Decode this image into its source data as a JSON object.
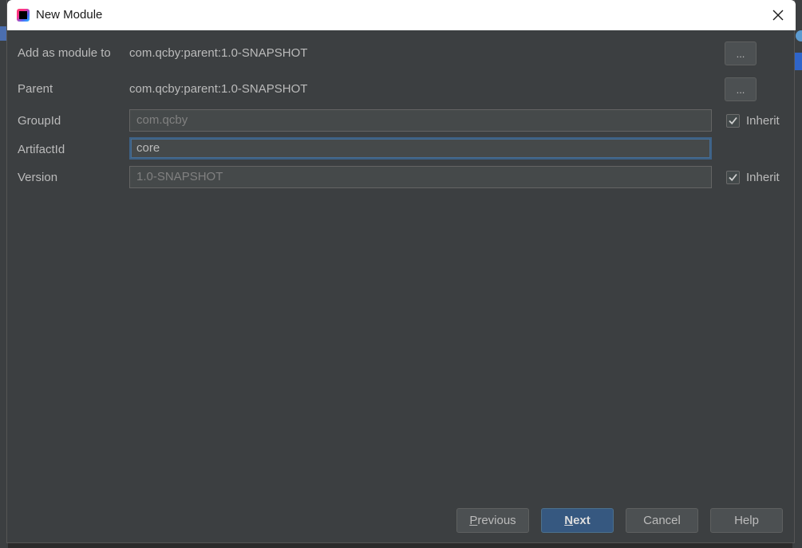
{
  "window": {
    "title": "New Module"
  },
  "form": {
    "add_as_module_label": "Add as module to",
    "add_as_module_value": "com.qcby:parent:1.0-SNAPSHOT",
    "parent_label": "Parent",
    "parent_value": "com.qcby:parent:1.0-SNAPSHOT",
    "browse_label": "...",
    "groupid_label": "GroupId",
    "groupid_value": "com.qcby",
    "artifactid_label": "ArtifactId",
    "artifactid_value": "core",
    "version_label": "Version",
    "version_value": "1.0-SNAPSHOT",
    "inherit_label": "Inherit",
    "groupid_inherit_checked": true,
    "version_inherit_checked": true
  },
  "buttons": {
    "previous_mnemonic": "P",
    "previous_rest": "revious",
    "next_mnemonic": "N",
    "next_rest": "ext",
    "cancel": "Cancel",
    "help": "Help"
  },
  "colors": {
    "dialog_bg": "#3c3f41",
    "titlebar_bg": "#ffffff",
    "text": "#bbbbbb",
    "primary_button": "#365880",
    "focus_border": "#3d6185"
  }
}
